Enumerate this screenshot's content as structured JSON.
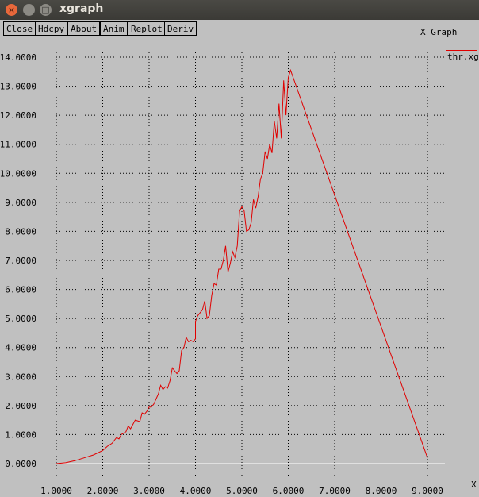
{
  "window": {
    "title": "xgraph",
    "close_glyph": "×",
    "min_glyph": "−",
    "max_glyph": "□"
  },
  "toolbar": {
    "buttons": [
      "Close",
      "Hdcpy",
      "About",
      "Anim",
      "Replot",
      "Deriv"
    ]
  },
  "graph": {
    "title": "X Graph",
    "legend_label": "thr.xg",
    "x_axis_label": "X"
  },
  "colors": {
    "background": "#c0c0c0",
    "series": "#e00000",
    "grid": "#000000",
    "zero_line": "#ffffff"
  },
  "chart_data": {
    "type": "line",
    "title": "X Graph",
    "xlabel": "X",
    "ylabel": "",
    "xlim": [
      1.0,
      9.0
    ],
    "ylim": [
      0.0,
      14.0
    ],
    "x_ticks": [
      "1.0000",
      "2.0000",
      "3.0000",
      "4.0000",
      "5.0000",
      "6.0000",
      "7.0000",
      "8.0000",
      "9.0000"
    ],
    "y_ticks": [
      "0.0000",
      "1.0000",
      "2.0000",
      "3.0000",
      "4.0000",
      "5.0000",
      "6.0000",
      "7.0000",
      "8.0000",
      "9.0000",
      "10.0000",
      "11.0000",
      "12.0000",
      "13.0000",
      "14.0000"
    ],
    "grid": true,
    "legend": "top-right",
    "series": [
      {
        "name": "thr.xg",
        "points": [
          [
            1.0,
            0.0
          ],
          [
            1.2,
            0.03
          ],
          [
            1.4,
            0.1
          ],
          [
            1.6,
            0.2
          ],
          [
            1.8,
            0.3
          ],
          [
            2.0,
            0.45
          ],
          [
            2.1,
            0.6
          ],
          [
            2.2,
            0.7
          ],
          [
            2.3,
            0.9
          ],
          [
            2.35,
            0.85
          ],
          [
            2.4,
            1.0
          ],
          [
            2.5,
            1.1
          ],
          [
            2.55,
            1.3
          ],
          [
            2.6,
            1.2
          ],
          [
            2.7,
            1.5
          ],
          [
            2.8,
            1.45
          ],
          [
            2.85,
            1.75
          ],
          [
            2.9,
            1.7
          ],
          [
            2.95,
            1.8
          ],
          [
            3.0,
            1.95
          ],
          [
            3.05,
            1.95
          ],
          [
            3.1,
            2.05
          ],
          [
            3.2,
            2.4
          ],
          [
            3.25,
            2.7
          ],
          [
            3.3,
            2.55
          ],
          [
            3.35,
            2.65
          ],
          [
            3.4,
            2.6
          ],
          [
            3.45,
            2.85
          ],
          [
            3.5,
            3.3
          ],
          [
            3.55,
            3.2
          ],
          [
            3.6,
            3.1
          ],
          [
            3.65,
            3.2
          ],
          [
            3.7,
            3.9
          ],
          [
            3.75,
            4.0
          ],
          [
            3.8,
            4.35
          ],
          [
            3.85,
            4.2
          ],
          [
            3.9,
            4.25
          ],
          [
            3.95,
            4.2
          ],
          [
            4.0,
            4.3
          ],
          [
            4.0,
            4.9
          ],
          [
            4.05,
            5.1
          ],
          [
            4.15,
            5.3
          ],
          [
            4.2,
            5.6
          ],
          [
            4.25,
            5.0
          ],
          [
            4.3,
            5.1
          ],
          [
            4.35,
            5.8
          ],
          [
            4.4,
            6.2
          ],
          [
            4.45,
            6.15
          ],
          [
            4.5,
            6.7
          ],
          [
            4.55,
            6.7
          ],
          [
            4.6,
            7.0
          ],
          [
            4.65,
            7.5
          ],
          [
            4.7,
            6.6
          ],
          [
            4.75,
            6.9
          ],
          [
            4.8,
            7.3
          ],
          [
            4.85,
            7.1
          ],
          [
            4.9,
            7.5
          ],
          [
            4.95,
            8.7
          ],
          [
            5.0,
            8.85
          ],
          [
            5.05,
            8.7
          ],
          [
            5.1,
            8.0
          ],
          [
            5.15,
            8.05
          ],
          [
            5.2,
            8.3
          ],
          [
            5.25,
            9.1
          ],
          [
            5.3,
            8.8
          ],
          [
            5.35,
            9.2
          ],
          [
            5.4,
            9.8
          ],
          [
            5.45,
            10.0
          ],
          [
            5.5,
            10.75
          ],
          [
            5.55,
            10.5
          ],
          [
            5.6,
            11.0
          ],
          [
            5.65,
            10.7
          ],
          [
            5.7,
            11.8
          ],
          [
            5.75,
            11.2
          ],
          [
            5.8,
            12.4
          ],
          [
            5.85,
            11.2
          ],
          [
            5.9,
            13.2
          ],
          [
            5.95,
            12.0
          ],
          [
            6.0,
            13.3
          ],
          [
            6.05,
            13.55
          ],
          [
            9.0,
            0.2
          ]
        ]
      }
    ]
  }
}
